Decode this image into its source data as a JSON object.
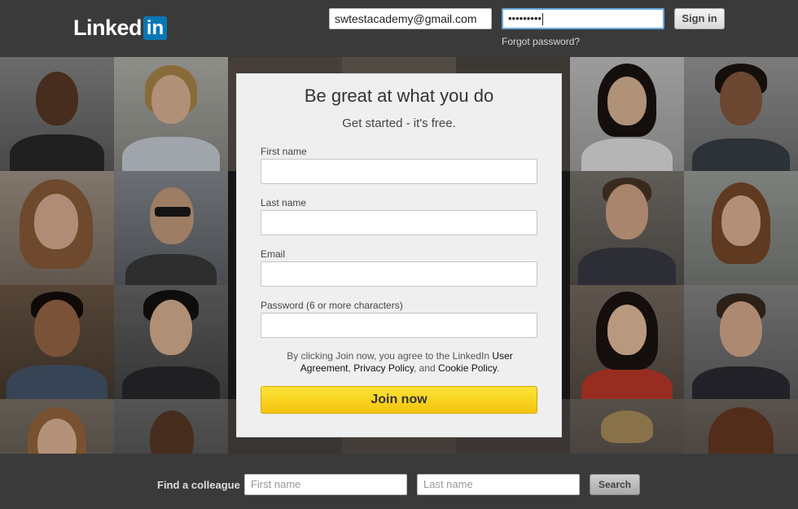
{
  "brand": {
    "name": "Linked",
    "name_badge": "in",
    "badge_color": "#0a77b5"
  },
  "header": {
    "email_value": "swtestacademy@gmail.com",
    "password_value": "•••••••••",
    "signin_label": "Sign in",
    "forgot_label": "Forgot password?"
  },
  "signup": {
    "title": "Be great at what you do",
    "subtitle": "Get started - it's free.",
    "fields": [
      {
        "label": "First name",
        "value": ""
      },
      {
        "label": "Last name",
        "value": ""
      },
      {
        "label": "Email",
        "value": ""
      },
      {
        "label": "Password (6 or more characters)",
        "value": ""
      }
    ],
    "terms_prefix": "By clicking Join now, you agree to the LinkedIn",
    "terms_link_1": "User Agreement",
    "terms_sep_1": ",",
    "terms_link_2": "Privacy Policy",
    "terms_sep_2": ", and",
    "terms_link_3": "Cookie Policy",
    "terms_end": ".",
    "join_label": "Join now",
    "join_color": "#f7d117"
  },
  "footer": {
    "find_label": "Find a colleague",
    "first_placeholder": "First name",
    "last_placeholder": "Last name",
    "search_label": "Search"
  }
}
